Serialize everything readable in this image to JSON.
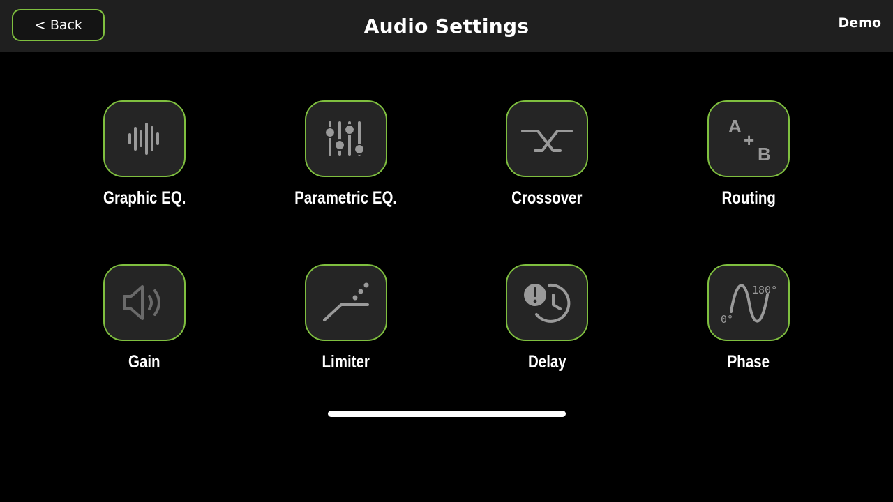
{
  "header": {
    "back_label": "Back",
    "title": "Audio Settings",
    "demo_label": "Demo"
  },
  "tiles": [
    {
      "label": "Graphic EQ.",
      "icon": "waveform-icon"
    },
    {
      "label": "Parametric EQ.",
      "icon": "sliders-icon"
    },
    {
      "label": "Crossover",
      "icon": "crossover-icon"
    },
    {
      "label": "Routing",
      "icon": "routing-a-plus-b-icon"
    },
    {
      "label": "Gain",
      "icon": "speaker-volume-icon"
    },
    {
      "label": "Limiter",
      "icon": "limiter-curve-icon"
    },
    {
      "label": "Delay",
      "icon": "delay-clock-alert-icon"
    },
    {
      "label": "Phase",
      "icon": "phase-sine-wave-icon"
    }
  ],
  "routing_icon_text": {
    "a": "A",
    "plus": "+",
    "b": "B"
  },
  "phase_icon_text": {
    "start": "0°",
    "end": "180°"
  },
  "colors": {
    "accent_border": "#7fbf3f",
    "header_bg": "#1f1f1f",
    "tile_bg": "#252525",
    "icon_gray": "#9a9a9a",
    "background": "#000000"
  }
}
